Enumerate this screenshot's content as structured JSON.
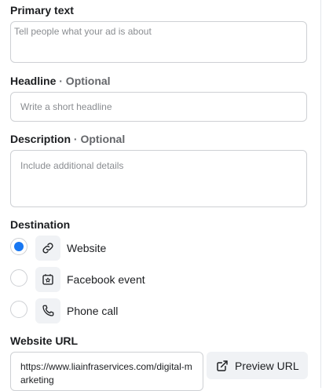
{
  "primary_text": {
    "label": "Primary text",
    "placeholder": "Tell people what your ad is about"
  },
  "headline": {
    "label": "Headline",
    "optional": " · Optional",
    "placeholder": "Write a short headline"
  },
  "description": {
    "label": "Description",
    "optional": " · Optional",
    "placeholder": "Include additional details"
  },
  "destination": {
    "label": "Destination",
    "options": [
      {
        "label": "Website",
        "icon": "link-icon",
        "selected": true
      },
      {
        "label": "Facebook event",
        "icon": "calendar-star-icon",
        "selected": false
      },
      {
        "label": "Phone call",
        "icon": "phone-icon",
        "selected": false
      }
    ]
  },
  "website_url": {
    "label": "Website URL",
    "value": "https://www.liainfraservices.com/digital-marketing",
    "preview_label": "Preview URL"
  },
  "colors": {
    "accent": "#1877f2",
    "border": "#ced0d4",
    "tile": "#f0f2f5"
  }
}
